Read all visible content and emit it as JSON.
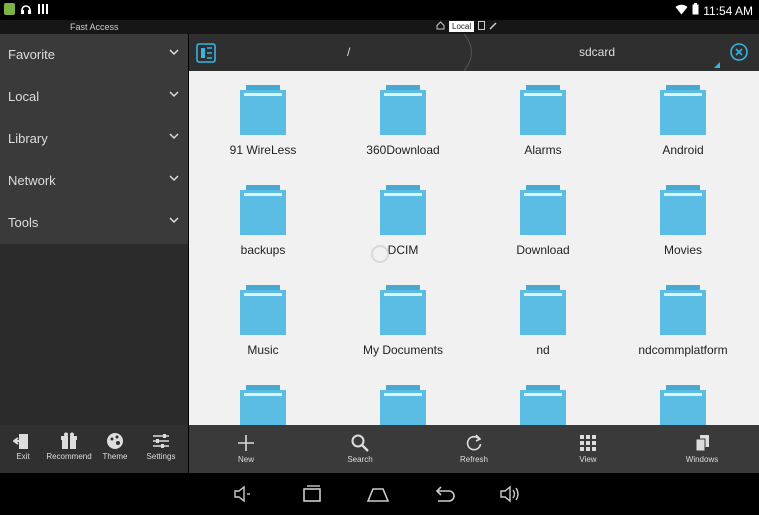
{
  "status": {
    "time": "11:54 AM"
  },
  "strip": {
    "title": "Fast Access",
    "local_tag": "Local"
  },
  "sidebar": {
    "items": [
      {
        "label": "Favorite"
      },
      {
        "label": "Local"
      },
      {
        "label": "Library"
      },
      {
        "label": "Network"
      },
      {
        "label": "Tools"
      }
    ],
    "bottom": [
      {
        "label": "Exit",
        "icon": "exit-icon"
      },
      {
        "label": "Recommend",
        "icon": "gift-icon"
      },
      {
        "label": "Theme",
        "icon": "palette-icon"
      },
      {
        "label": "Settings",
        "icon": "sliders-icon"
      }
    ]
  },
  "path": {
    "root": "/",
    "current": "sdcard"
  },
  "folders": [
    "91 WireLess",
    "360Download",
    "Alarms",
    "Android",
    "backups",
    "DCIM",
    "Download",
    "Movies",
    "Music",
    "My Documents",
    "nd",
    "ndcommplatform",
    "",
    "",
    "",
    ""
  ],
  "toolbar": [
    {
      "label": "New",
      "icon": "plus-icon"
    },
    {
      "label": "Search",
      "icon": "search-icon"
    },
    {
      "label": "Refresh",
      "icon": "refresh-icon"
    },
    {
      "label": "View",
      "icon": "grid-icon"
    },
    {
      "label": "Windows",
      "icon": "windows-icon"
    }
  ],
  "colors": {
    "folder": "#5bbce4",
    "folder_tab": "#4aa9d3",
    "accent": "#33b5e5"
  }
}
